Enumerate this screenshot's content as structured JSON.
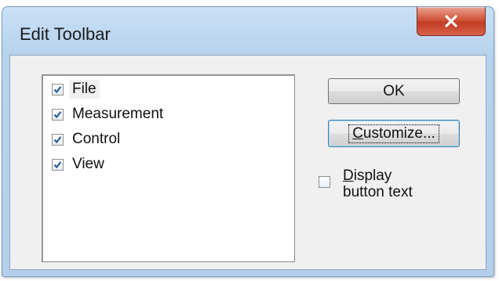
{
  "window": {
    "title": "Edit Toolbar"
  },
  "toolbars": {
    "items": [
      {
        "label": "File",
        "checked": true
      },
      {
        "label": "Measurement",
        "checked": true
      },
      {
        "label": "Control",
        "checked": true
      },
      {
        "label": "View",
        "checked": true
      }
    ]
  },
  "buttons": {
    "ok_label": "OK",
    "customize_hotkey": "C",
    "customize_rest": "ustomize..."
  },
  "display_text": {
    "hotkey": "D",
    "line1_rest": "isplay",
    "line2": "button text",
    "checked": false
  },
  "colors": {
    "accent": "#3c7fb1",
    "close": "#c13d22",
    "checkmark": "#2a5f9e"
  },
  "icons": {
    "close": "close-icon",
    "check": "checkmark-icon"
  }
}
